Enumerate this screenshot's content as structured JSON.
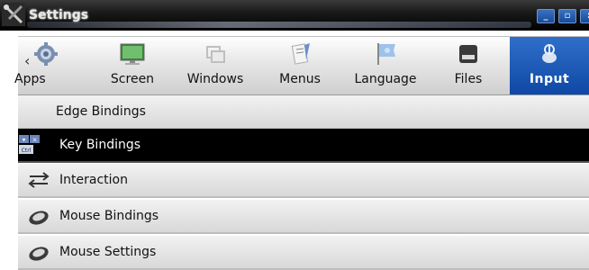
{
  "window": {
    "title": "Settings"
  },
  "titlebar_buttons": [
    {
      "name": "minimize",
      "glyph": "_"
    },
    {
      "name": "maximize",
      "glyph": "▫"
    },
    {
      "name": "close",
      "glyph": ":"
    }
  ],
  "toolbar": {
    "tabs": [
      {
        "label": "Apps",
        "icon": "gear-icon"
      },
      {
        "label": "Screen",
        "icon": "monitor-icon"
      },
      {
        "label": "Windows",
        "icon": "windows-icon"
      },
      {
        "label": "Menus",
        "icon": "menus-icon"
      },
      {
        "label": "Language",
        "icon": "flag-icon"
      },
      {
        "label": "Files",
        "icon": "drive-icon"
      },
      {
        "label": "Input",
        "icon": "input-icon",
        "active": true
      }
    ],
    "scroll_left_glyph": "‹"
  },
  "list": {
    "items": [
      {
        "label": "Edge Bindings",
        "icon": "none"
      },
      {
        "label": "Key Bindings",
        "icon": "keyboard-keys-icon",
        "selected": true,
        "key_glyphs": [
          "▾",
          "×",
          "Ctrl"
        ]
      },
      {
        "label": "Interaction",
        "icon": "arrows-swap-icon"
      },
      {
        "label": "Mouse Bindings",
        "icon": "mouse-icon"
      },
      {
        "label": "Mouse Settings",
        "icon": "mouse-icon"
      }
    ]
  },
  "colors": {
    "accent": "#1a56b0",
    "titlebar": "#000000",
    "selected_row": "#000000"
  }
}
